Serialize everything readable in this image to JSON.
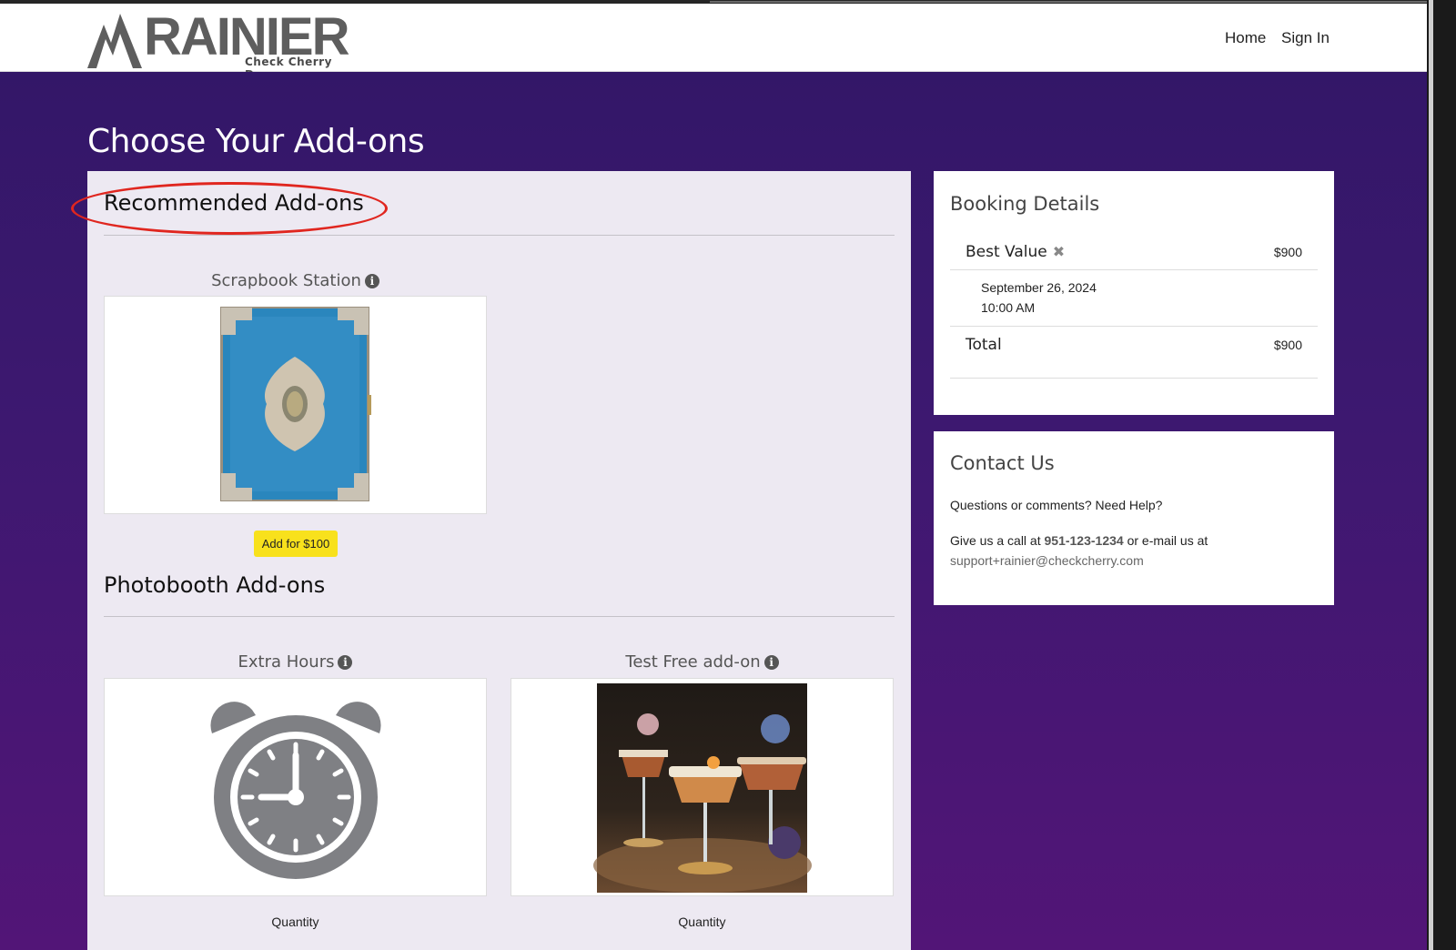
{
  "header": {
    "logo_text": "RAINIER",
    "logo_tagline": "Check Cherry Demo",
    "nav": {
      "home": "Home",
      "sign_in": "Sign In"
    }
  },
  "page": {
    "title": "Choose Your Add-ons"
  },
  "sections": [
    {
      "title": "Recommended Add-ons",
      "addons": [
        {
          "name": "Scrapbook Station",
          "button": "Add for $100",
          "image": "blue-ornate-book"
        }
      ]
    },
    {
      "title": "Photobooth Add-ons",
      "addons": [
        {
          "name": "Extra Hours",
          "quantity_label": "Quantity",
          "image": "alarm-clock-icon"
        },
        {
          "name": "Test Free add-on",
          "quantity_label": "Quantity",
          "image": "cocktail-glasses-photo"
        }
      ]
    }
  ],
  "booking": {
    "title": "Booking Details",
    "package": "Best Value",
    "package_price": "$900",
    "date": "September 26, 2024",
    "time": "10:00 AM",
    "total_label": "Total",
    "total": "$900"
  },
  "contact": {
    "title": "Contact Us",
    "question": "Questions or comments? Need Help?",
    "call_prefix": "Give us a call at",
    "phone": "951-123-1234",
    "email_prefix": "or e-mail us at",
    "email": "support+rainier@checkcherry.com"
  },
  "colors": {
    "purple_top": "#331768",
    "purple_bottom": "#521577",
    "panel": "#ede9f2",
    "add_button": "#f8e11c",
    "highlight": "#e0261f"
  }
}
